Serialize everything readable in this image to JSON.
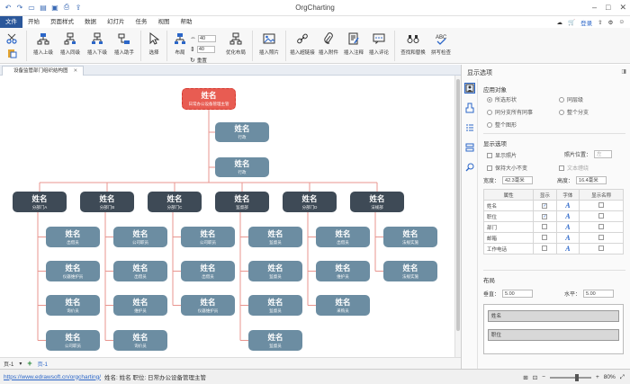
{
  "window": {
    "title": "OrgCharting"
  },
  "menu": {
    "items": [
      "文件",
      "开始",
      "页面样式",
      "数据",
      "幻灯片",
      "任务",
      "视图",
      "帮助"
    ],
    "login": "登录"
  },
  "ribbon": {
    "buttons": [
      "插入上级",
      "插入同级",
      "插入下级",
      "插入助手",
      "选择",
      "布局",
      "优化布局",
      "插入照片",
      "插入超链接",
      "插入附件",
      "插入注释",
      "插入评论",
      "查找和替换",
      "拼写检查"
    ],
    "spin1": "40",
    "spin2": "40",
    "reset": "重置"
  },
  "tab": {
    "label": "设备监管部门组织结构图"
  },
  "chart": {
    "root": {
      "name": "姓名",
      "role": "日常办公设备管理主管"
    },
    "assistants": [
      {
        "name": "姓名",
        "role": "行政"
      },
      {
        "name": "姓名",
        "role": "行政"
      }
    ],
    "departments": [
      {
        "name": "姓名",
        "role": "分部门A",
        "members": [
          {
            "name": "姓名",
            "role": "出借员"
          },
          {
            "name": "姓名",
            "role": "仪器维护员"
          },
          {
            "name": "姓名",
            "role": "询价员"
          },
          {
            "name": "姓名",
            "role": "公司职员"
          }
        ]
      },
      {
        "name": "姓名",
        "role": "分部门B",
        "members": [
          {
            "name": "姓名",
            "role": "公司职员"
          },
          {
            "name": "姓名",
            "role": "出借员"
          },
          {
            "name": "姓名",
            "role": "维护员"
          },
          {
            "name": "姓名",
            "role": "询价员"
          }
        ]
      },
      {
        "name": "姓名",
        "role": "分部门C",
        "members": [
          {
            "name": "姓名",
            "role": "公司职员"
          },
          {
            "name": "姓名",
            "role": "出借员"
          },
          {
            "name": "姓名",
            "role": "仪器维护员"
          }
        ]
      },
      {
        "name": "姓名",
        "role": "监督部",
        "members": [
          {
            "name": "姓名",
            "role": "监督员"
          },
          {
            "name": "姓名",
            "role": "监督员"
          },
          {
            "name": "姓名",
            "role": "监督员"
          },
          {
            "name": "姓名",
            "role": "监督员"
          }
        ]
      },
      {
        "name": "姓名",
        "role": "分部门D",
        "members": [
          {
            "name": "姓名",
            "role": "出借员"
          },
          {
            "name": "姓名",
            "role": "维护员"
          },
          {
            "name": "姓名",
            "role": "采购员"
          }
        ]
      },
      {
        "name": "姓名",
        "role": "法规部",
        "members": [
          {
            "name": "姓名",
            "role": "法规实施"
          },
          {
            "name": "姓名",
            "role": "法规实施"
          }
        ]
      }
    ]
  },
  "panel": {
    "title": "显示选项",
    "apply_label": "应用对象",
    "apply_options": [
      "所选形状",
      "同层级",
      "同分支所有同事",
      "整个分支",
      "整个图形"
    ],
    "display_label": "显示选项",
    "show_photo": "显示照片",
    "photo_pos_label": "照片位置：",
    "photo_pos_value": "左",
    "keep_size": "保持大小不变",
    "text_wrap": "文本缠绕",
    "width_label": "宽度：",
    "width_value": "42.3毫米",
    "height_label": "高度：",
    "height_value": "16.4毫米",
    "table_headers": [
      "属性",
      "显示",
      "字体",
      "显示名称"
    ],
    "table_rows": [
      "姓名",
      "职位",
      "部门",
      "邮箱",
      "工作电话"
    ],
    "font_glyph": "A",
    "layout_label": "布局",
    "vertical_label": "垂直：",
    "vertical_value": "5.00",
    "horizontal_label": "水平：",
    "horizontal_value": "5.00",
    "preview": [
      "姓名",
      "职位"
    ]
  },
  "pagebar": {
    "page_select": "页-1",
    "page_tab": "页-1"
  },
  "status": {
    "url": "https://www.edrawsoft.cn/orgcharting/",
    "info": "姓名: 姓名  职位: 日常办公设备管理主管",
    "zoom": "80%"
  }
}
